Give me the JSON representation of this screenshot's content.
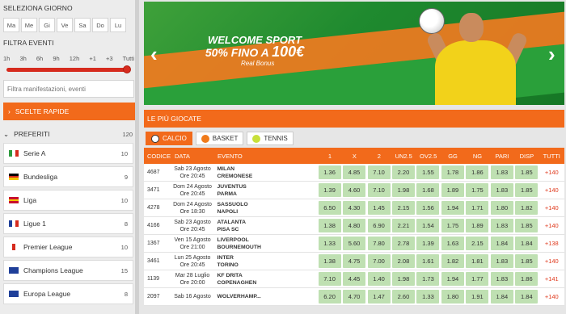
{
  "sidebar": {
    "day_label": "SELEZIONA GIORNO",
    "days": [
      "Ma",
      "Me",
      "Gi",
      "Ve",
      "Sa",
      "Do",
      "Lu"
    ],
    "filter_label": "FILTRA EVENTI",
    "hours": [
      "1h",
      "3h",
      "6h",
      "9h",
      "12h",
      "+1",
      "+3",
      "Tutti"
    ],
    "search_placeholder": "Filtra manifestazioni, eventi",
    "quick_choices": "SCELTE RAPIDE",
    "favorites_label": "PREFERITI",
    "favorites_count": "120",
    "favorites": [
      {
        "label": "Serie A",
        "count": "10",
        "flag": [
          "#2e9a3e",
          "#ffffff",
          "#d62b1e"
        ],
        "dir": "row"
      },
      {
        "label": "Bundesliga",
        "count": "9",
        "flag": [
          "#000000",
          "#d62b1e",
          "#f2c600"
        ],
        "dir": "column"
      },
      {
        "label": "Liga",
        "count": "10",
        "flag": [
          "#c8102e",
          "#f2c600",
          "#c8102e"
        ],
        "dir": "column"
      },
      {
        "label": "Ligue 1",
        "count": "8",
        "flag": [
          "#1f3f99",
          "#ffffff",
          "#d62b1e"
        ],
        "dir": "row"
      },
      {
        "label": "Premier League",
        "count": "10",
        "flag": [
          "#ffffff",
          "#d62b1e",
          "#ffffff"
        ],
        "dir": "row"
      },
      {
        "label": "Champions League",
        "count": "15",
        "flag": [
          "#1f3f99",
          "#1f3f99",
          "#1f3f99"
        ],
        "dir": "row"
      },
      {
        "label": "Europa League",
        "count": "8",
        "flag": [
          "#1f3f99",
          "#1f3f99",
          "#1f3f99"
        ],
        "dir": "row"
      }
    ]
  },
  "banner": {
    "line1": "WELCOME SPORT",
    "line2a": "50% FINO A ",
    "line2b": "100€",
    "brand": "Real Bonus"
  },
  "section_title": "LE PIÙ GIOCATE",
  "tabs": [
    {
      "label": "CALCIO",
      "color": "#ffffff"
    },
    {
      "label": "BASKET",
      "color": "#f07b1b"
    },
    {
      "label": "TENNIS",
      "color": "#c8e03a"
    }
  ],
  "table": {
    "headers": [
      "CODICE",
      "DATA",
      "EVENTO",
      "1",
      "X",
      "2",
      "UN2.5",
      "OV2.5",
      "GG",
      "NG",
      "Pari",
      "Disp",
      "Tutti"
    ],
    "rows": [
      {
        "code": "4687",
        "date1": "Sab 23 Agosto",
        "date2": "Ore 20:45",
        "home": "MILAN",
        "away": "CREMONESE",
        "odds": [
          "1.36",
          "4.85",
          "7.10",
          "2.20",
          "1.55",
          "1.78",
          "1.86",
          "1.83",
          "1.85"
        ],
        "all": "+140"
      },
      {
        "code": "3471",
        "date1": "Dom 24 Agosto",
        "date2": "Ore 20:45",
        "home": "JUVENTUS",
        "away": "PARMA",
        "odds": [
          "1.39",
          "4.60",
          "7.10",
          "1.98",
          "1.68",
          "1.89",
          "1.75",
          "1.83",
          "1.85"
        ],
        "all": "+140"
      },
      {
        "code": "4278",
        "date1": "Dom 24 Agosto",
        "date2": "Ore 18:30",
        "home": "SASSUOLO",
        "away": "NAPOLI",
        "odds": [
          "6.50",
          "4.30",
          "1.45",
          "2.15",
          "1.56",
          "1.94",
          "1.71",
          "1.80",
          "1.82"
        ],
        "all": "+140"
      },
      {
        "code": "4166",
        "date1": "Sab 23 Agosto",
        "date2": "Ore 20:45",
        "home": "ATALANTA",
        "away": "PISA SC",
        "odds": [
          "1.38",
          "4.80",
          "6.90",
          "2.21",
          "1.54",
          "1.75",
          "1.89",
          "1.83",
          "1.85"
        ],
        "all": "+140"
      },
      {
        "code": "1367",
        "date1": "Ven 15 Agosto",
        "date2": "Ore 21:00",
        "home": "LIVERPOOL",
        "away": "BOURNEMOUTH",
        "odds": [
          "1.33",
          "5.60",
          "7.80",
          "2.78",
          "1.39",
          "1.63",
          "2.15",
          "1.84",
          "1.84"
        ],
        "all": "+138"
      },
      {
        "code": "3461",
        "date1": "Lun 25 Agosto",
        "date2": "Ore 20:45",
        "home": "INTER",
        "away": "TORINO",
        "odds": [
          "1.38",
          "4.75",
          "7.00",
          "2.08",
          "1.61",
          "1.82",
          "1.81",
          "1.83",
          "1.85"
        ],
        "all": "+140"
      },
      {
        "code": "1139",
        "date1": "Mar 28 Luglio",
        "date2": "Ore 20:00",
        "home": "KF DRITA",
        "away": "COPENAGHEN",
        "odds": [
          "7.10",
          "4.45",
          "1.40",
          "1.98",
          "1.73",
          "1.94",
          "1.77",
          "1.83",
          "1.86"
        ],
        "all": "+141"
      },
      {
        "code": "2097",
        "date1": "Sab 16 Agosto",
        "date2": "",
        "home": "WOLVERHAMP...",
        "away": "",
        "odds": [
          "6.20",
          "4.70",
          "1.47",
          "2.60",
          "1.33",
          "1.80",
          "1.91",
          "1.84",
          "1.84"
        ],
        "all": "+140"
      }
    ]
  }
}
